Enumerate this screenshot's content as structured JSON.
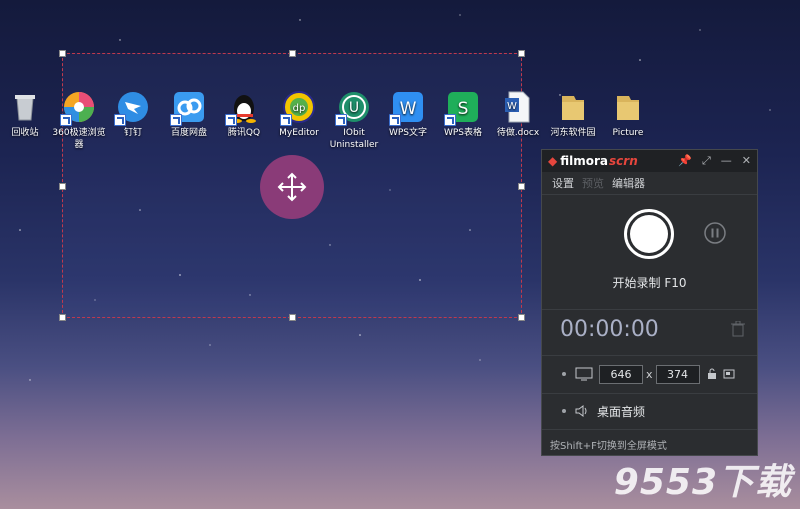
{
  "desktop": {
    "icons": [
      {
        "label": "回收站",
        "icon": "recycle-bin-icon"
      },
      {
        "label": "360极速浏览器",
        "icon": "360-browser-icon"
      },
      {
        "label": "钉钉",
        "icon": "dingtalk-icon"
      },
      {
        "label": "百度网盘",
        "icon": "baidu-netdisk-icon"
      },
      {
        "label": "腾讯QQ",
        "icon": "qq-penguin-icon"
      },
      {
        "label": "MyEditor",
        "icon": "myeditor-icon"
      },
      {
        "label": "IObit Uninstaller",
        "icon": "iobit-uninstaller-icon"
      },
      {
        "label": "WPS文字",
        "icon": "wps-writer-icon"
      },
      {
        "label": "WPS表格",
        "icon": "wps-spreadsheet-icon"
      },
      {
        "label": "待做.docx",
        "icon": "word-doc-icon"
      },
      {
        "label": "河东软件园",
        "icon": "folder-icon"
      },
      {
        "label": "Picture",
        "icon": "folder-icon"
      }
    ]
  },
  "panel": {
    "brand": "filmora",
    "brand_suffix": "scrn",
    "menu": {
      "settings": "设置",
      "preview": "预览",
      "editor": "编辑器"
    },
    "record_label": "开始录制 F10",
    "timer": "00:00:00",
    "width": "646",
    "height": "374",
    "times": "x",
    "audio_label": "桌面音频",
    "hint": "按Shift+F切换到全屏模式"
  },
  "watermark": "9553下载",
  "colors": {
    "accent_red": "#e6463d",
    "mover": "#8a3b78",
    "panel_bg": "#2b2d30",
    "region_border": "#c0394d"
  }
}
